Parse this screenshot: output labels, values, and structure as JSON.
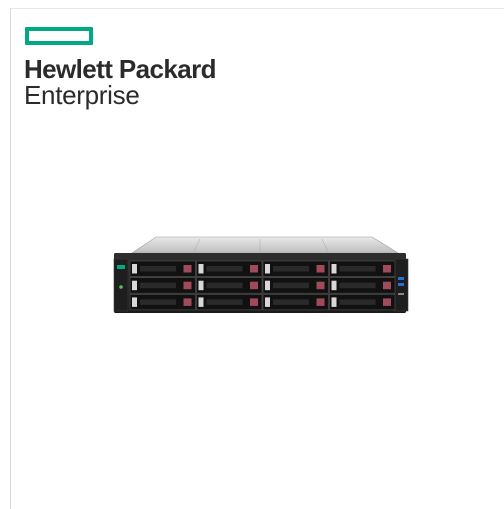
{
  "brand": {
    "line1": "Hewlett Packard",
    "line2": "Enterprise",
    "accent_color": "#01a982"
  },
  "product_image": {
    "drive_bays": 12,
    "rows": 3,
    "columns": 4
  }
}
